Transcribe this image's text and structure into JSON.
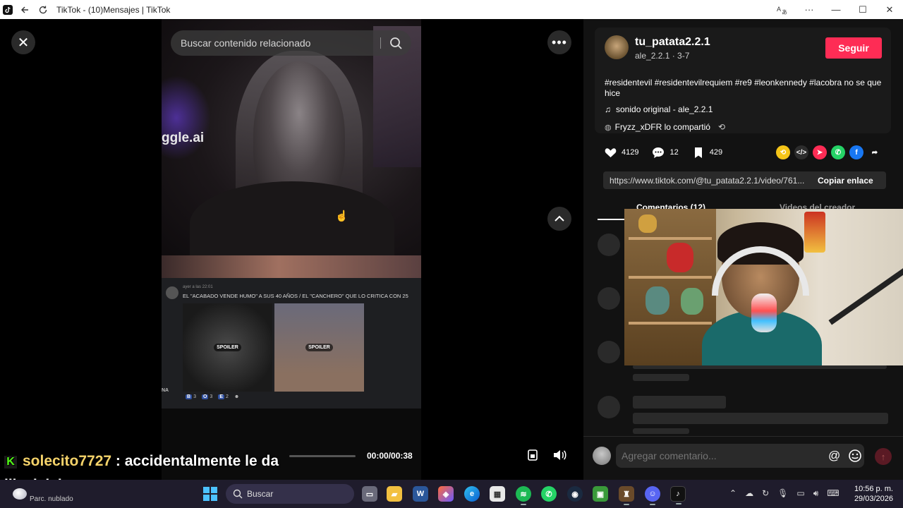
{
  "window": {
    "title": "TikTok - (10)Mensajes | TikTok"
  },
  "player": {
    "search_placeholder": "Buscar contenido relacionado",
    "video_watermark": "ggle.ai",
    "time": "00:00/00:38",
    "progress": 0.0,
    "discord": {
      "meta": "ayer a las 22:01",
      "message": "EL \"ACABADO VENDE HUMO\" A SUS 40 AÑOS / EL \"CANCHERO\" QUE LO CRITICA CON 25",
      "spoiler_label": "SPOILER",
      "side_text": "NA",
      "reactions": [
        {
          "badge": "B",
          "count": "3"
        },
        {
          "badge": "O",
          "count": "3"
        },
        {
          "badge": "E",
          "count": "2"
        }
      ]
    }
  },
  "post": {
    "username": "tu_patata2.2.1",
    "subname": "ale_2.2.1 · 3-7",
    "follow_label": "Seguir",
    "caption": "#residentevil #residentevilrequiem #re9 #leonkennedy #lacobra no se que hice",
    "sound": "sonido original - ale_2.2.1",
    "shared_by": "Fryzz_xDFR lo compartió",
    "likes": "4129",
    "comments": "12",
    "saves": "429",
    "link": "https://www.tiktok.com/@tu_patata2.2.1/video/761...",
    "copy_label": "Copiar enlace",
    "tab_comments": "Comentarios (12)",
    "tab_creator": "Videos del creador",
    "comment_placeholder": "Agregar comentario..."
  },
  "stream_chat": {
    "user": "solecito7727",
    "message_line1": ": accidentalmente le da",
    "message_line2": "like jajaja"
  },
  "taskbar": {
    "weather_temp": "",
    "weather_desc": "Parc. nublado",
    "search_label": "Buscar",
    "time": "10:56 p. m.",
    "date": "29/03/2026"
  }
}
